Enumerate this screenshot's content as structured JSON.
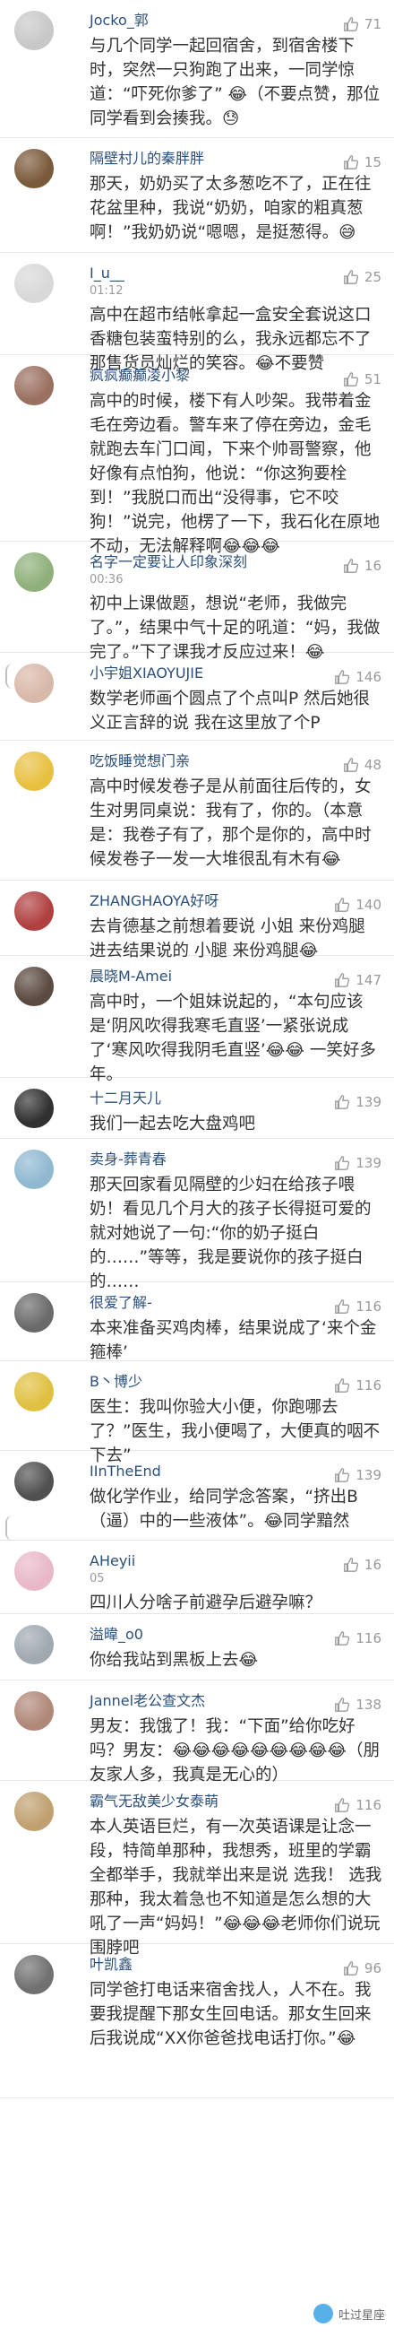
{
  "comments": [
    {
      "user": "Jocko_郭",
      "time": "",
      "likes": "71",
      "text": "与几个同学一起回宿舍，到宿舍楼下时，突然一只狗跑了出来，一同学惊道：“吓死你爹了” 😂（不要点赞，那位同学看到会揍我。😓",
      "avatar_color": "#c8c8c8"
    },
    {
      "user": "隔壁村儿的秦胖胖",
      "time": "",
      "likes": "15",
      "text": "那天，奶奶买了太多葱吃不了，正在往花盆里种，我说“奶奶，咱家的粗真葱啊！”我奶奶说“嗯嗯，是挺葱得。😅",
      "avatar_color": "#7a5a3a"
    },
    {
      "user": "I_u__",
      "time": "01:12",
      "likes": "25",
      "text": "高中在超市结帐拿起一盒安全套说这口香糖包装蛮特别的么，我永远都忘不了那售货员灿烂的笑容。😂不要赞",
      "avatar_color": "#d8d8d8"
    },
    {
      "user": "疯疯癫癫凌小黎",
      "time": "",
      "likes": "51",
      "text": "高中的时候，楼下有人吵架。我带着金毛在旁边看。警车来了停在旁边，金毛就跑去车门口闻，下来个帅哥警察，他好像有点怕狗，他说：“你这狗要栓到！”我脱口而出“没得事，它不咬狗！”说完，他楞了一下，我石化在原地不动，无法解释啊😂😂😂",
      "avatar_color": "#9a7060"
    },
    {
      "user": "名字一定要让人印象深刻",
      "time": "00:36",
      "likes": "16",
      "text": "初中上课做题，想说“老师，我做完了。”，结果中气十足的吼道：“妈，我做完了。”下了课我才反应过来！😂",
      "avatar_color": "#8fb07a"
    },
    {
      "user": "小宇姐XIAOYUJIE",
      "time": "",
      "likes": "146",
      "text": "数学老师画个圆点了个点叫P 然后她很义正言辞的说 我在这里放了个P",
      "avatar_color": "#d8b8a8"
    },
    {
      "user": "吃饭睡觉想门亲",
      "time": "",
      "likes": "48",
      "text": "高中时候发卷子是从前面往后传的，女生对男同桌说：我有了，你的。（本意是：我卷子有了，那个是你的，高中时候发卷子一发一大堆很乱有木有😂",
      "avatar_color": "#e8c040"
    },
    {
      "user": "ZHANGHAOYA好呀",
      "time": "",
      "likes": "140",
      "text": "去肯德基之前想着要说 小姐 来份鸡腿 进去结果说的 小腿 来份鸡腿😂",
      "avatar_color": "#b04040"
    },
    {
      "user": "晨晓M-Amei",
      "time": "",
      "likes": "147",
      "text": "高中时，一个姐妹说起的，“本句应该是‘阴风吹得我寒毛直竖’一紧张说成了‘寒风吹得我阴毛直竖’😂😂 一笑好多年。",
      "avatar_color": "#5a4a40"
    },
    {
      "user": "十二月天儿",
      "time": "",
      "likes": "139",
      "text": "我们一起去吃大盘鸡吧",
      "avatar_color": "#303030"
    },
    {
      "user": "卖身-葬青春",
      "time": "",
      "likes": "139",
      "text": "那天回家看见隔壁的少妇在给孩子喂奶！看见几个月大的孩子长得挺可爱的就对她说了一句:“你的奶子挺白的……”等等，我是要说你的孩子挺白的……",
      "avatar_color": "#90b8d0"
    },
    {
      "user": "很爱了解-",
      "time": "",
      "likes": "116",
      "text": "本来准备买鸡肉棒，结果说成了‘来个金箍棒’",
      "avatar_color": "#6a6a6a"
    },
    {
      "user": "B丶博少",
      "time": "",
      "likes": "116",
      "text": "医生：我叫你验大小便，你跑哪去了？”医生，我小便喝了，大便真的咽不下去”",
      "avatar_color": "#e0c040"
    },
    {
      "user": "IInTheEnd",
      "time": "",
      "likes": "139",
      "text": "做化学作业，给同学念答案，“挤出B（逼）中的一些液体”。😂同学黯然",
      "avatar_color": "#505050"
    },
    {
      "user": "AHeyii",
      "time": "05",
      "likes": "16",
      "text": "四川人分啥子前避孕后避孕嘛？",
      "avatar_color": "#e8b8c8"
    },
    {
      "user": "溢暐_o0",
      "time": "",
      "likes": "116",
      "text": "你给我站到黑板上去😂",
      "avatar_color": "#a0a8b0"
    },
    {
      "user": "Jannel老公查文杰",
      "time": "",
      "likes": "138",
      "text": "男友：我饿了！我：“下面”给你吃好吗？男友：😂😂😂😂😂😂😂😂😂（朋友家人多，我真是无心的）",
      "avatar_color": "#b08878"
    },
    {
      "user": "霸气无敌美少女泰萌",
      "time": "",
      "likes": "116",
      "text": "本人英语巨烂，有一次英语课是让念一段，特简单那种，我想秀，班里的学霸全都举手，我就举出来是说 选我！ 选我那种，我太着急也不知道是怎么想的大吼了一声“妈妈！”😂😂😂老师你们说玩围脖吧",
      "avatar_color": "#c0a070"
    },
    {
      "user": "叶凯鑫",
      "time": "",
      "likes": "96",
      "text": "同学爸打电话来宿舍找人，人不在。我要我提醒下那女生回电话。那女生回来后我说成“XX你爸爸找电话打你。”😂",
      "avatar_color": "#707070"
    }
  ],
  "watermark": "吐过星座"
}
